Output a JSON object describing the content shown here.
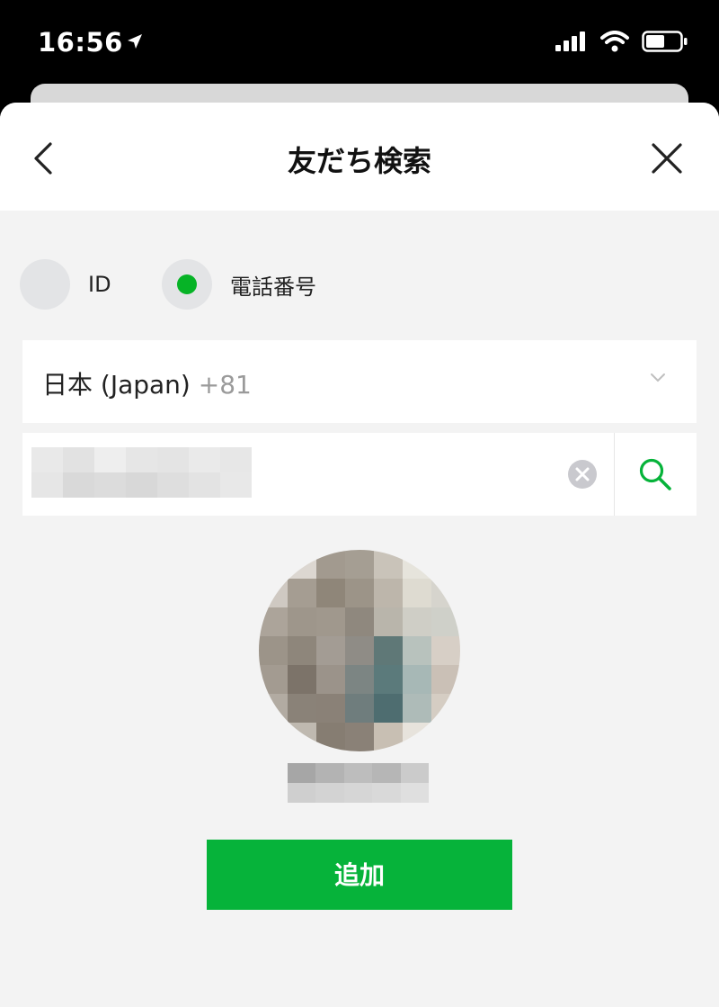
{
  "status_bar": {
    "time": "16:56",
    "location_icon": "location-arrow-icon",
    "icons": [
      "cellular-signal-icon",
      "wifi-icon",
      "battery-icon"
    ]
  },
  "header": {
    "title": "友だち検索",
    "back_icon": "chevron-left-icon",
    "close_icon": "close-icon"
  },
  "search_type": {
    "options": [
      {
        "label": "ID",
        "selected": false
      },
      {
        "label": "電話番号",
        "selected": true
      }
    ]
  },
  "country_select": {
    "name": "日本 (Japan)",
    "code": "+81",
    "icon": "chevron-down-icon"
  },
  "phone_search": {
    "value_obscured": true,
    "clear_icon": "clear-circle-icon",
    "search_icon": "search-icon"
  },
  "result": {
    "avatar_obscured": true,
    "name_obscured": true
  },
  "actions": {
    "add_label": "追加"
  },
  "colors": {
    "accent": "#06b33a",
    "background": "#f3f3f3",
    "status_bar": "#000000"
  }
}
